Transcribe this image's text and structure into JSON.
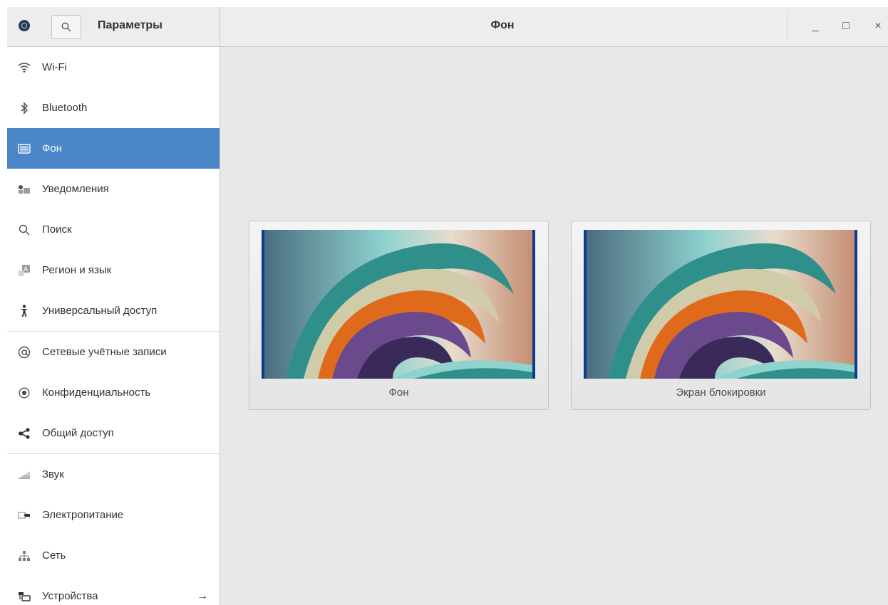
{
  "window": {
    "sidebar_title": "Параметры",
    "page_title": "Фон"
  },
  "window_controls": {
    "minimize_glyph": "_",
    "maximize_glyph": "□",
    "close_glyph": "×"
  },
  "sidebar": {
    "items": [
      {
        "label": "Wi-Fi",
        "icon": "wifi-icon"
      },
      {
        "label": "Bluetooth",
        "icon": "bluetooth-icon"
      },
      {
        "label": "Фон",
        "icon": "background-icon",
        "selected": true
      },
      {
        "label": "Уведомления",
        "icon": "notifications-icon"
      },
      {
        "label": "Поиск",
        "icon": "search-icon"
      },
      {
        "label": "Регион и язык",
        "icon": "region-language-icon"
      },
      {
        "label": "Универсальный доступ",
        "icon": "accessibility-icon"
      },
      {
        "label": "Сетевые учётные записи",
        "icon": "online-accounts-icon"
      },
      {
        "label": "Конфиденциальность",
        "icon": "privacy-icon"
      },
      {
        "label": "Общий доступ",
        "icon": "sharing-icon"
      },
      {
        "label": "Звук",
        "icon": "sound-icon"
      },
      {
        "label": "Электропитание",
        "icon": "power-icon"
      },
      {
        "label": "Сеть",
        "icon": "network-icon"
      },
      {
        "label": "Устройства",
        "icon": "devices-icon",
        "arrow": "→"
      }
    ]
  },
  "content": {
    "cards": [
      {
        "label": "Фон"
      },
      {
        "label": "Экран блокировки"
      }
    ]
  },
  "colors": {
    "accent": "#4a86c8",
    "content_bg": "#e8e8e7",
    "thumb_border": "#0a3d8f"
  }
}
